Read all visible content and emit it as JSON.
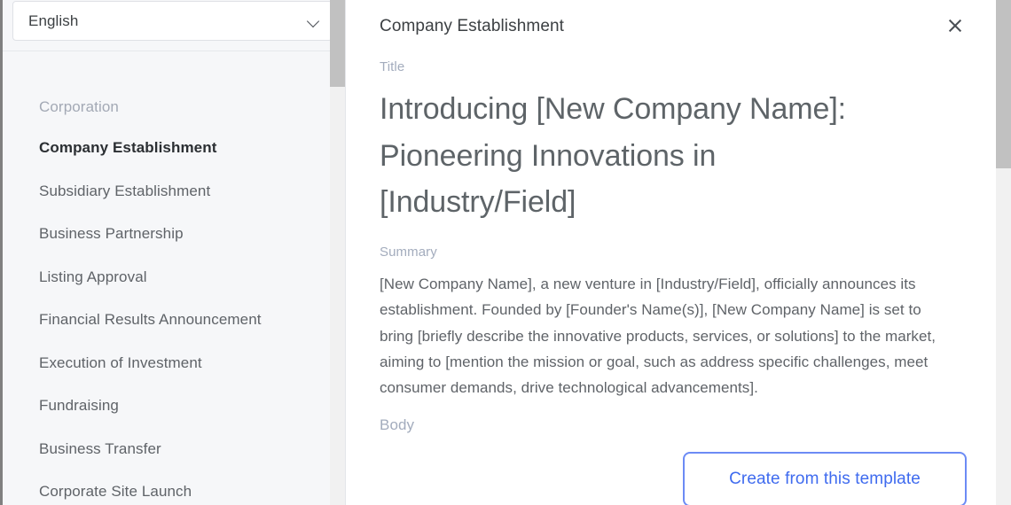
{
  "colors": {
    "sidebar_bg": "#f6f7f9",
    "panel_bg": "#ffffff",
    "accent_blue": "#3f6bef",
    "button_border": "#6c8bf5",
    "muted_label": "#a3acbd",
    "body_text": "#5f6368",
    "scrollbar_thumb": "#c1c1c1"
  },
  "sidebar": {
    "language_select": {
      "value": "English",
      "icon": "chevron-down-icon"
    },
    "group_label": "Corporation",
    "items": [
      {
        "label": "Company Establishment",
        "selected": true
      },
      {
        "label": "Subsidiary Establishment",
        "selected": false
      },
      {
        "label": "Business Partnership",
        "selected": false
      },
      {
        "label": "Listing Approval",
        "selected": false
      },
      {
        "label": "Financial Results Announcement",
        "selected": false
      },
      {
        "label": "Execution of Investment",
        "selected": false
      },
      {
        "label": "Fundraising",
        "selected": false
      },
      {
        "label": "Business Transfer",
        "selected": false
      },
      {
        "label": "Corporate Site Launch",
        "selected": false
      }
    ]
  },
  "panel": {
    "header": {
      "title": "Company Establishment",
      "close_icon": "close-icon"
    },
    "fields": {
      "title_label": "Title",
      "title_value": "Introducing [New Company Name]: Pioneering Innovations in [Industry/Field]",
      "summary_label": "Summary",
      "summary_value": "[New Company Name], a new venture in [Industry/Field], officially announces its establishment. Founded by [Founder's Name(s)], [New Company Name] is set to bring [briefly describe the innovative products, services, or solutions] to the market, aiming to [mention the mission or goal, such as address specific challenges, meet consumer demands, drive technological advancements].",
      "body_label": "Body"
    },
    "cta_button": "Create from this template"
  }
}
